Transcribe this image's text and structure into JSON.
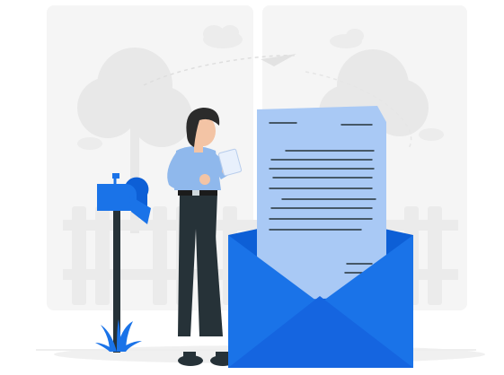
{
  "illustration": {
    "subject": "woman-reading-letter-from-envelope",
    "icons": [
      "mailbox-icon",
      "envelope-icon",
      "letter-icon",
      "paper-plane-icon",
      "tree-icon",
      "cloud-icon",
      "fence-icon",
      "plant-icon"
    ]
  },
  "colors": {
    "background": "#ffffff",
    "window": "#f4f4f4",
    "scenery": "#e4e4e4",
    "accent_blue": "#1a73e8",
    "envelope_dark": "#0d5fd6",
    "letter_paper": "#a9c9f5",
    "shirt": "#8fb8ec",
    "pants": "#263238",
    "hair": "#2b2b2b",
    "skin": "#f3c4a5",
    "ink": "#263238"
  }
}
